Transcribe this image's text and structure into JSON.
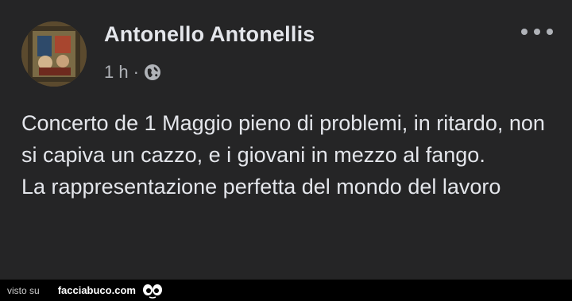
{
  "post": {
    "author": "Antonello Antonellis",
    "time": "1 h",
    "separator": "·",
    "audience_icon": "globe-icon",
    "more_icon": "more-options-icon",
    "text": "Concerto de 1 Maggio pieno di problemi, in ritardo, non si capiva un cazzo, e i giovani in mezzo al fango.\nLa rappresentazione perfetta del mondo del lavoro"
  },
  "footer": {
    "visto_label": "visto su",
    "site": "facciabuco.com",
    "logo_icon": "eyes-icon"
  }
}
